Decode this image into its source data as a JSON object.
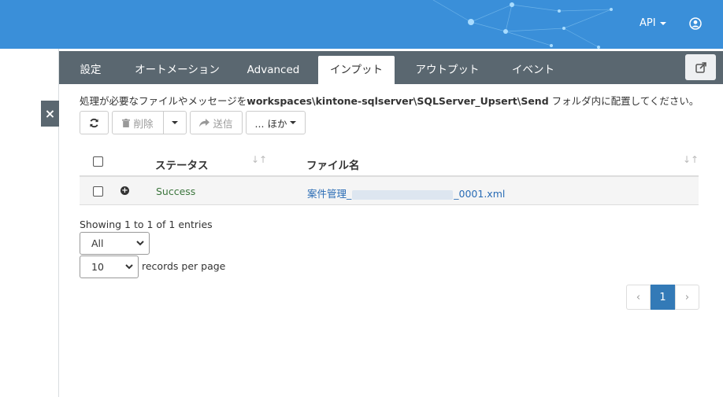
{
  "header": {
    "api_label": "API",
    "icons": {
      "api_caret": "caret-down-icon",
      "user": "user-circle-icon"
    }
  },
  "sidebar": {
    "close_label": "×"
  },
  "tabs": [
    {
      "label": "設定",
      "active": false
    },
    {
      "label": "オートメーション",
      "active": false
    },
    {
      "label": "Advanced",
      "active": false
    },
    {
      "label": "インプット",
      "active": true
    },
    {
      "label": "アウトプット",
      "active": false
    },
    {
      "label": "イベント",
      "active": false
    }
  ],
  "info": {
    "prefix": "処理が必要なファイルやメッセージを",
    "path": "workspaces\\kintone-sqlserver\\SQLServer_Upsert\\Send",
    "suffix": " フォルダ内に配置してください。"
  },
  "toolbar": {
    "delete_label": "削除",
    "send_label": "送信",
    "more_label": "... ほか",
    "icons": {
      "refresh": "refresh-icon",
      "delete": "trash-icon",
      "send": "share-arrow-icon"
    }
  },
  "table": {
    "columns": [
      "ステータス",
      "ファイル名"
    ],
    "rows": [
      {
        "status": "Success",
        "file_prefix": "案件管理_",
        "file_suffix": "_0001.xml"
      }
    ]
  },
  "footer": {
    "showing": "Showing 1 to 1 of 1 entries",
    "filter_value": "All",
    "per_page_value": "10",
    "per_page_label": "records per page"
  },
  "pagination": {
    "prev": "‹",
    "current": "1",
    "next": "›"
  },
  "colors": {
    "header_bg": "#3a8fd9",
    "tabbar_bg": "#5a6770",
    "status_success": "#3c763d",
    "link": "#2a6cb5",
    "page_active": "#337ab7"
  }
}
